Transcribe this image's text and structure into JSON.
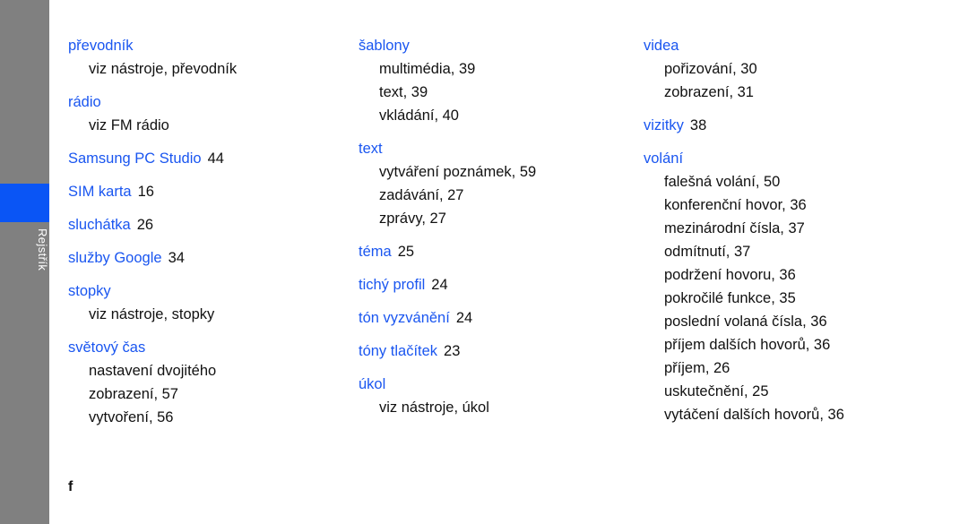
{
  "sidebar": {
    "label": "Rejstřík",
    "highlight_color": "#0a55f5",
    "background_color": "#808080"
  },
  "page": {
    "footer_letter": "f",
    "headword_color": "#1a56f0",
    "text_color": "#111111"
  },
  "columns": [
    {
      "entries": [
        {
          "headword": "převodník",
          "page": "",
          "subentries": [
            {
              "text": "viz nástroje, převodník"
            }
          ]
        },
        {
          "headword": "rádio",
          "page": "",
          "subentries": [
            {
              "text": "viz FM rádio"
            }
          ]
        },
        {
          "headword": "Samsung PC Studio",
          "page": "44",
          "subentries": []
        },
        {
          "headword": "SIM karta",
          "page": "16",
          "subentries": []
        },
        {
          "headword": "sluchátka",
          "page": "26",
          "subentries": []
        },
        {
          "headword": "služby Google",
          "page": "34",
          "subentries": []
        },
        {
          "headword": "stopky",
          "page": "",
          "subentries": [
            {
              "text": "viz nástroje, stopky"
            }
          ]
        },
        {
          "headword": "světový čas",
          "page": "",
          "subentries": [
            {
              "text": "nastavení dvojitého"
            },
            {
              "text": "zobrazení, 57"
            },
            {
              "text": "vytvoření, 56"
            }
          ]
        }
      ]
    },
    {
      "entries": [
        {
          "headword": "šablony",
          "page": "",
          "subentries": [
            {
              "text": "multimédia, 39"
            },
            {
              "text": "text, 39"
            },
            {
              "text": "vkládání, 40"
            }
          ]
        },
        {
          "headword": "text",
          "page": "",
          "subentries": [
            {
              "text": "vytváření poznámek, 59"
            },
            {
              "text": "zadávání, 27"
            },
            {
              "text": "zprávy, 27"
            }
          ]
        },
        {
          "headword": "téma",
          "page": "25",
          "subentries": []
        },
        {
          "headword": "tichý profil",
          "page": "24",
          "subentries": []
        },
        {
          "headword": "tón vyzvánění",
          "page": "24",
          "subentries": []
        },
        {
          "headword": "tóny tlačítek",
          "page": "23",
          "subentries": []
        },
        {
          "headword": "úkol",
          "page": "",
          "subentries": [
            {
              "text": "viz nástroje, úkol"
            }
          ]
        }
      ]
    },
    {
      "entries": [
        {
          "headword": "videa",
          "page": "",
          "subentries": [
            {
              "text": "pořizování, 30"
            },
            {
              "text": "zobrazení, 31"
            }
          ]
        },
        {
          "headword": "vizitky",
          "page": "38",
          "subentries": []
        },
        {
          "headword": "volání",
          "page": "",
          "subentries": [
            {
              "text": "falešná volání, 50"
            },
            {
              "text": "konferenční hovor, 36"
            },
            {
              "text": "mezinárodní čísla, 37"
            },
            {
              "text": "odmítnutí, 37"
            },
            {
              "text": "podržení hovoru, 36"
            },
            {
              "text": "pokročilé funkce, 35"
            },
            {
              "text": "poslední volaná čísla, 36"
            },
            {
              "text": "příjem dalších hovorů, 36"
            },
            {
              "text": "příjem, 26"
            },
            {
              "text": "uskutečnění, 25"
            },
            {
              "text": "vytáčení dalších hovorů, 36"
            }
          ]
        }
      ]
    }
  ]
}
